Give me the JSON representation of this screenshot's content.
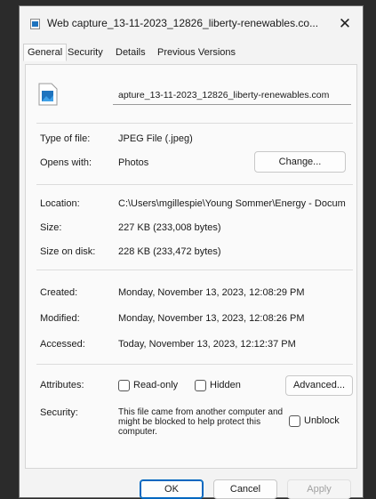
{
  "window": {
    "title": "Web capture_13-11-2023_12826_liberty-renewables.co...",
    "close_glyph": "✕"
  },
  "tabs": [
    {
      "label": "General",
      "active": true
    },
    {
      "label": "Security",
      "active": false
    },
    {
      "label": "Details",
      "active": false
    },
    {
      "label": "Previous Versions",
      "active": false
    }
  ],
  "file": {
    "name": "apture_13-11-2023_12826_liberty-renewables.com",
    "icon": "image-file-icon"
  },
  "type_section": {
    "type_label": "Type of file:",
    "type_value": "JPEG File (.jpeg)",
    "opens_label": "Opens with:",
    "opens_value": "Photos",
    "change_button": "Change..."
  },
  "location_section": {
    "location_label": "Location:",
    "location_value": "C:\\Users\\mgillespie\\Young Sommer\\Energy - Docum",
    "size_label": "Size:",
    "size_value": "227 KB (233,008 bytes)",
    "disk_label": "Size on disk:",
    "disk_value": "228 KB (233,472 bytes)"
  },
  "dates_section": {
    "created_label": "Created:",
    "created_value": "Monday, November 13, 2023, 12:08:29 PM",
    "modified_label": "Modified:",
    "modified_value": "Monday, November 13, 2023, 12:08:26 PM",
    "accessed_label": "Accessed:",
    "accessed_value": "Today, November 13, 2023, 12:12:37 PM"
  },
  "attributes_section": {
    "attributes_label": "Attributes:",
    "readonly_label": "Read-only",
    "hidden_label": "Hidden",
    "advanced_button": "Advanced...",
    "security_label": "Security:",
    "security_text": "This file came from another computer and might be blocked to help protect this computer.",
    "unblock_label": "Unblock"
  },
  "footer": {
    "ok": "OK",
    "cancel": "Cancel",
    "apply": "Apply"
  },
  "colors": {
    "accent": "#0067c0",
    "dialog_bg": "#f3f3f3",
    "backdrop": "#2b2b2b"
  }
}
